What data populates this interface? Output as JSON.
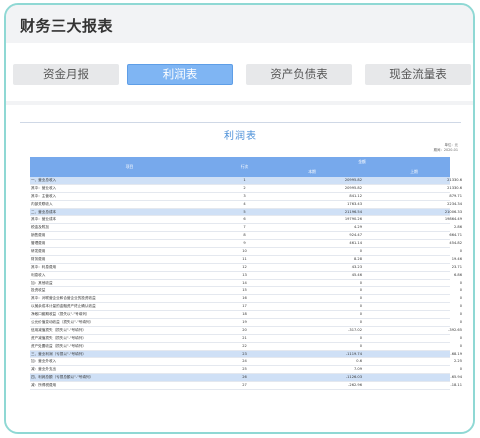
{
  "page_title": "财务三大报表",
  "tabs": [
    {
      "label": "资金月报",
      "active": false
    },
    {
      "label": "利润表",
      "active": true
    },
    {
      "label": "资产负债表",
      "active": false
    },
    {
      "label": "现金流量表",
      "active": false
    }
  ],
  "report": {
    "title": "利润表",
    "unit": "单位：元",
    "period": "期间：2020-01",
    "headers": {
      "item": "项目",
      "line_no": "行次",
      "amount": "金额",
      "current": "本期",
      "previous": "上期"
    },
    "rows": [
      {
        "name": "一、营业总收入",
        "no": "1",
        "cur": "20995.82",
        "prev": "21330.6",
        "sec": true
      },
      {
        "name": "其中：营业收入",
        "no": "2",
        "cur": "20995.82",
        "prev": "21330.6",
        "sec": false
      },
      {
        "name": "其中：主营收入",
        "no": "3",
        "cur": "841.12",
        "prev": "879.71",
        "sec": false
      },
      {
        "name": "内部关联收入",
        "no": "4",
        "cur": "1763.43",
        "prev": "2234.34",
        "sec": false
      },
      {
        "name": "二、营业总成本",
        "no": "5",
        "cur": "21196.54",
        "prev": "21006.33",
        "sec": true
      },
      {
        "name": "其中：营业成本",
        "no": "6",
        "cur": "19790.26",
        "prev": "19864.49",
        "sec": false
      },
      {
        "name": "税金及附加",
        "no": "7",
        "cur": "4.29",
        "prev": "2.86",
        "sec": false
      },
      {
        "name": "销售费用",
        "no": "8",
        "cur": "924.47",
        "prev": "664.71",
        "sec": false
      },
      {
        "name": "管理费用",
        "no": "9",
        "cur": "461.14",
        "prev": "454.82",
        "sec": false
      },
      {
        "name": "研发费用",
        "no": "10",
        "cur": "0",
        "prev": "0",
        "sec": false
      },
      {
        "name": "财务费用",
        "no": "11",
        "cur": "8.28",
        "prev": "19.46",
        "sec": false
      },
      {
        "name": "其中：利息费用",
        "no": "12",
        "cur": "43.23",
        "prev": "23.71",
        "sec": false
      },
      {
        "name": "利息收入",
        "no": "13",
        "cur": "45.46",
        "prev": "6.86",
        "sec": false
      },
      {
        "name": "加：其他收益",
        "no": "14",
        "cur": "0",
        "prev": "0",
        "sec": false
      },
      {
        "name": "投资收益",
        "no": "15",
        "cur": "0",
        "prev": "0",
        "sec": false
      },
      {
        "name": "其中：对联营企业和合营企业的投资收益",
        "no": "16",
        "cur": "0",
        "prev": "0",
        "sec": false
      },
      {
        "name": "以摊余成本计量的金融资产终止确认收益",
        "no": "17",
        "cur": "0",
        "prev": "0",
        "sec": false
      },
      {
        "name": "净敞口套期收益（损失以\"-\"号填列）",
        "no": "18",
        "cur": "0",
        "prev": "0",
        "sec": false
      },
      {
        "name": "公允价值变动收益（损失以\"-\"号填列）",
        "no": "19",
        "cur": "0",
        "prev": "0",
        "sec": false
      },
      {
        "name": "信用减值损失（损失以\"-\"号填列）",
        "no": "20",
        "cur": "-317.02",
        "prev": "-392.65",
        "sec": false
      },
      {
        "name": "资产减值损失（损失以\"-\"号填列）",
        "no": "21",
        "cur": "0",
        "prev": "0",
        "sec": false
      },
      {
        "name": "资产处置收益（损失以\"-\"号填列）",
        "no": "22",
        "cur": "0",
        "prev": "0",
        "sec": false
      },
      {
        "name": "三、营业利润（亏损以\"-\"号填列）",
        "no": "23",
        "cur": "-1119.74",
        "prev": "-68.19",
        "sec": true
      },
      {
        "name": "加：营业外收入",
        "no": "24",
        "cur": "0.6",
        "prev": "2.25",
        "sec": false
      },
      {
        "name": "减：营业外支出",
        "no": "25",
        "cur": "7.09",
        "prev": "0",
        "sec": false
      },
      {
        "name": "四、利润总额（亏损总额以\"-\"号填列）",
        "no": "26",
        "cur": "-1126.03",
        "prev": "-65.94",
        "sec": true
      },
      {
        "name": "减：所得税费用",
        "no": "27",
        "cur": "-262.96",
        "prev": "-18.11",
        "sec": false
      }
    ]
  }
}
